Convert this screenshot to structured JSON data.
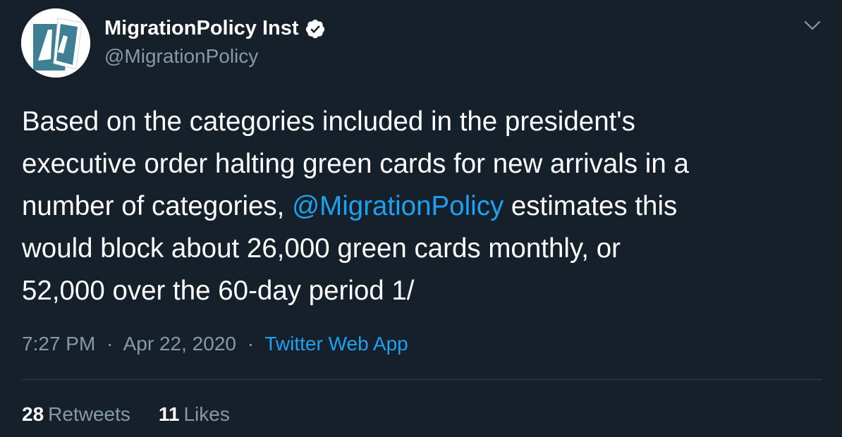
{
  "author": {
    "display_name": "MigrationPolicy Inst",
    "handle": "@MigrationPolicy",
    "verified": true
  },
  "tweet": {
    "lines": [
      [
        "Based on the categories included in the president's"
      ],
      [
        "executive order halting green cards for new arrivals in a"
      ],
      [
        "number of categories, ",
        "@MigrationPolicy",
        " estimates this"
      ],
      [
        "would block about 26,000 green cards monthly, or"
      ],
      [
        "52,000 over the 60-day period 1/"
      ]
    ]
  },
  "meta": {
    "time": "7:27 PM",
    "separator": "·",
    "date": "Apr 22, 2020",
    "source": "Twitter Web App"
  },
  "stats": {
    "retweets_count": "28",
    "retweets_label": "Retweets",
    "likes_count": "11",
    "likes_label": "Likes"
  },
  "colors": {
    "background": "#15202b",
    "text": "#ffffff",
    "secondary": "#8899a6",
    "accent": "#1da1f2",
    "divider": "#38444d"
  },
  "icons": {
    "verified": "verified-badge-icon",
    "caret": "chevron-down-icon"
  }
}
